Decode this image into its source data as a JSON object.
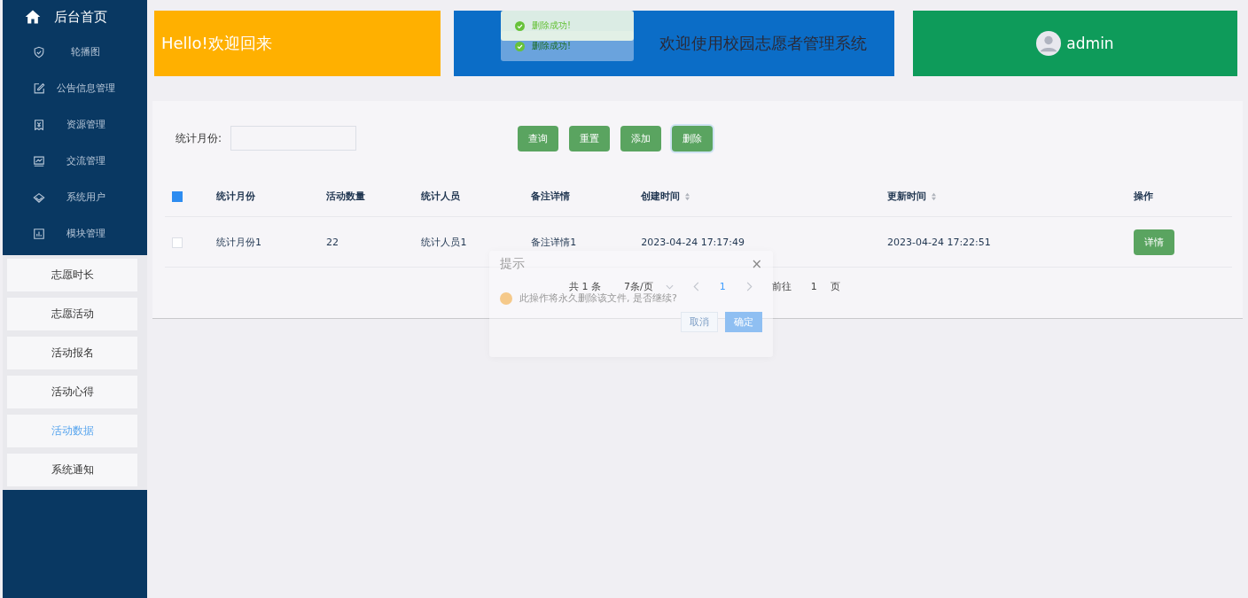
{
  "sidebar": {
    "home": "后台首页",
    "menu": [
      {
        "label": "轮播图",
        "kind": "shield"
      },
      {
        "label": "公告信息管理",
        "kind": "edit"
      },
      {
        "label": "资源管理",
        "kind": "doc"
      },
      {
        "label": "交流管理",
        "kind": "chart"
      },
      {
        "label": "系统用户",
        "kind": "diamond"
      },
      {
        "label": "模块管理",
        "kind": "bars"
      }
    ],
    "submenu": [
      {
        "label": "志愿时长",
        "selected": false
      },
      {
        "label": "志愿活动",
        "selected": false
      },
      {
        "label": "活动报名",
        "selected": false
      },
      {
        "label": "活动心得",
        "selected": false
      },
      {
        "label": "活动数据",
        "selected": true
      },
      {
        "label": "系统通知",
        "selected": false
      }
    ]
  },
  "header": {
    "greeting": "Hello!欢迎回来",
    "title": "欢迎使用校园志愿者管理系统",
    "user": "admin"
  },
  "toasts": [
    "删除成功!",
    "删除成功!"
  ],
  "search": {
    "label": "统计月份:",
    "buttons": [
      "查询",
      "重置",
      "添加",
      "删除"
    ]
  },
  "table": {
    "header_checked": true,
    "columns": [
      {
        "label": "统计月份",
        "sortable": false
      },
      {
        "label": "活动数量",
        "sortable": false
      },
      {
        "label": "统计人员",
        "sortable": false
      },
      {
        "label": "备注详情",
        "sortable": false
      },
      {
        "label": "创建时间",
        "sortable": true
      },
      {
        "label": "更新时间",
        "sortable": true
      },
      {
        "label": "操作",
        "sortable": false
      }
    ],
    "rows": [
      {
        "checked": false,
        "cells": [
          "统计月份1",
          "22",
          "统计人员1",
          "备注详情1",
          "2023-04-24 17:17:49",
          "2023-04-24 17:22:51"
        ],
        "action": "详情"
      }
    ]
  },
  "pagination": {
    "total": "共 1 条",
    "page_size": "7条/页",
    "current": "1",
    "goto_label": "前往",
    "goto_value": "1",
    "page_unit": "页"
  },
  "dialog": {
    "title": "提示",
    "close": "×",
    "message": "此操作将永久删除该文件, 是否继续?",
    "cancel": "取消",
    "confirm": "确定"
  }
}
